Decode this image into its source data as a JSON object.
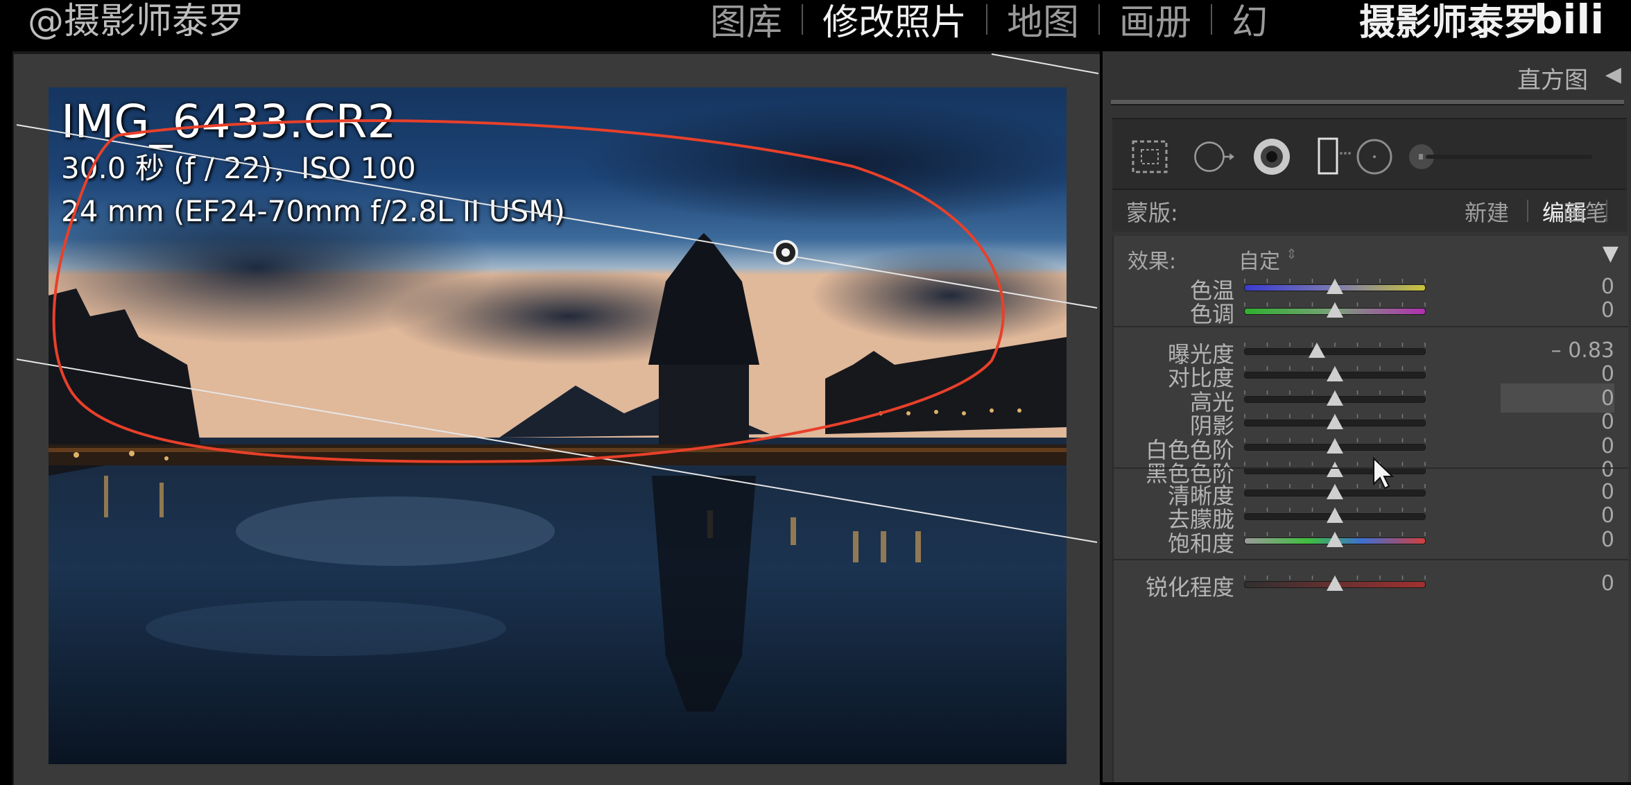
{
  "top": {
    "watermark_left": "@摄影师泰罗",
    "modules": [
      {
        "label": "图库",
        "active": false
      },
      {
        "label": "修改照片",
        "active": true
      },
      {
        "label": "地图",
        "active": false
      },
      {
        "label": "画册",
        "active": false
      },
      {
        "label": "幻",
        "active": false
      }
    ],
    "watermark_right": "摄影师泰罗"
  },
  "photo": {
    "filename": "IMG_6433.CR2",
    "exposure_line": "30.0 秒 (ƒ / 22)，ISO 100",
    "lens_line": "24 mm (EF24-70mm f/2.8L II USM)"
  },
  "panel": {
    "histogram_label": "直方图",
    "collapse_icon": "triangle-left-icon",
    "tools": [
      "crop-overlay-icon",
      "spot-removal-icon",
      "red-eye-icon",
      "graduated-filter-icon",
      "radial-filter-icon",
      "adjustment-brush-icon"
    ],
    "mask": {
      "label": "蒙版:",
      "options": [
        {
          "label": "新建",
          "active": false
        },
        {
          "label": "编辑",
          "active": true
        },
        {
          "label": "画笔",
          "active": false
        }
      ]
    },
    "effect": {
      "label": "效果:",
      "value": "自定",
      "arrows": "⇕",
      "triangle": "▼"
    },
    "groups": [
      [
        {
          "label": "色温",
          "value": "0",
          "position": 0.5,
          "track": "temp"
        },
        {
          "label": "色调",
          "value": "0",
          "position": 0.5,
          "track": "tint"
        }
      ],
      [
        {
          "label": "曝光度",
          "value": "– 0.83",
          "position": 0.4,
          "track": "dark"
        },
        {
          "label": "对比度",
          "value": "0",
          "position": 0.5,
          "track": "dark"
        },
        {
          "label": "高光",
          "value": "0",
          "position": 0.5,
          "track": "dark",
          "focused": true
        },
        {
          "label": "阴影",
          "value": "0",
          "position": 0.5,
          "track": "dark"
        },
        {
          "label": "白色色阶",
          "value": "0",
          "position": 0.5,
          "track": "dark"
        },
        {
          "label": "黑色色阶",
          "value": "0",
          "position": 0.5,
          "track": "dark"
        }
      ],
      [
        {
          "label": "清晰度",
          "value": "0",
          "position": 0.5,
          "track": "dark"
        },
        {
          "label": "去朦胧",
          "value": "0",
          "position": 0.5,
          "track": "dark"
        },
        {
          "label": "饱和度",
          "value": "0",
          "position": 0.5,
          "track": "saturation"
        }
      ],
      [
        {
          "label": "锐化程度",
          "value": "0",
          "position": 0.5,
          "track": "sharpen"
        }
      ]
    ],
    "colors": {
      "accent_annotation": "#e8402a",
      "panel_bg": "#3c3c3c"
    }
  }
}
